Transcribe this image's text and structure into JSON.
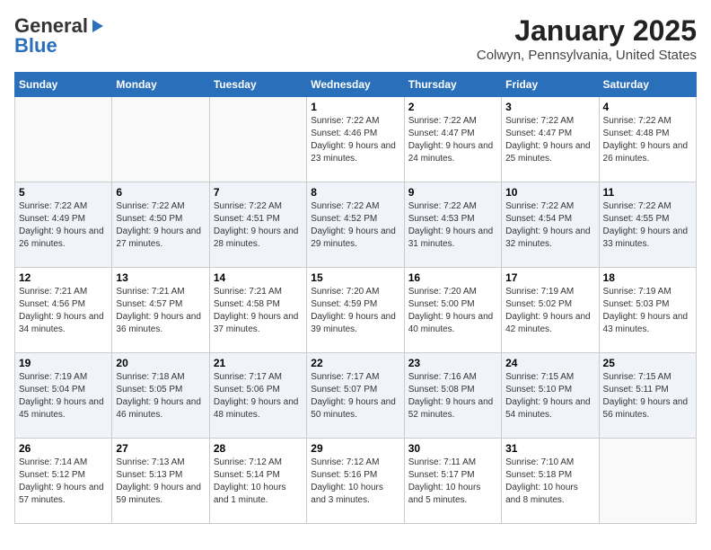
{
  "header": {
    "logo_general": "General",
    "logo_blue": "Blue",
    "month_title": "January 2025",
    "location": "Colwyn, Pennsylvania, United States"
  },
  "weekdays": [
    "Sunday",
    "Monday",
    "Tuesday",
    "Wednesday",
    "Thursday",
    "Friday",
    "Saturday"
  ],
  "weeks": [
    [
      {
        "day": "",
        "info": ""
      },
      {
        "day": "",
        "info": ""
      },
      {
        "day": "",
        "info": ""
      },
      {
        "day": "1",
        "info": "Sunrise: 7:22 AM\nSunset: 4:46 PM\nDaylight: 9 hours and 23 minutes."
      },
      {
        "day": "2",
        "info": "Sunrise: 7:22 AM\nSunset: 4:47 PM\nDaylight: 9 hours and 24 minutes."
      },
      {
        "day": "3",
        "info": "Sunrise: 7:22 AM\nSunset: 4:47 PM\nDaylight: 9 hours and 25 minutes."
      },
      {
        "day": "4",
        "info": "Sunrise: 7:22 AM\nSunset: 4:48 PM\nDaylight: 9 hours and 26 minutes."
      }
    ],
    [
      {
        "day": "5",
        "info": "Sunrise: 7:22 AM\nSunset: 4:49 PM\nDaylight: 9 hours and 26 minutes."
      },
      {
        "day": "6",
        "info": "Sunrise: 7:22 AM\nSunset: 4:50 PM\nDaylight: 9 hours and 27 minutes."
      },
      {
        "day": "7",
        "info": "Sunrise: 7:22 AM\nSunset: 4:51 PM\nDaylight: 9 hours and 28 minutes."
      },
      {
        "day": "8",
        "info": "Sunrise: 7:22 AM\nSunset: 4:52 PM\nDaylight: 9 hours and 29 minutes."
      },
      {
        "day": "9",
        "info": "Sunrise: 7:22 AM\nSunset: 4:53 PM\nDaylight: 9 hours and 31 minutes."
      },
      {
        "day": "10",
        "info": "Sunrise: 7:22 AM\nSunset: 4:54 PM\nDaylight: 9 hours and 32 minutes."
      },
      {
        "day": "11",
        "info": "Sunrise: 7:22 AM\nSunset: 4:55 PM\nDaylight: 9 hours and 33 minutes."
      }
    ],
    [
      {
        "day": "12",
        "info": "Sunrise: 7:21 AM\nSunset: 4:56 PM\nDaylight: 9 hours and 34 minutes."
      },
      {
        "day": "13",
        "info": "Sunrise: 7:21 AM\nSunset: 4:57 PM\nDaylight: 9 hours and 36 minutes."
      },
      {
        "day": "14",
        "info": "Sunrise: 7:21 AM\nSunset: 4:58 PM\nDaylight: 9 hours and 37 minutes."
      },
      {
        "day": "15",
        "info": "Sunrise: 7:20 AM\nSunset: 4:59 PM\nDaylight: 9 hours and 39 minutes."
      },
      {
        "day": "16",
        "info": "Sunrise: 7:20 AM\nSunset: 5:00 PM\nDaylight: 9 hours and 40 minutes."
      },
      {
        "day": "17",
        "info": "Sunrise: 7:19 AM\nSunset: 5:02 PM\nDaylight: 9 hours and 42 minutes."
      },
      {
        "day": "18",
        "info": "Sunrise: 7:19 AM\nSunset: 5:03 PM\nDaylight: 9 hours and 43 minutes."
      }
    ],
    [
      {
        "day": "19",
        "info": "Sunrise: 7:19 AM\nSunset: 5:04 PM\nDaylight: 9 hours and 45 minutes."
      },
      {
        "day": "20",
        "info": "Sunrise: 7:18 AM\nSunset: 5:05 PM\nDaylight: 9 hours and 46 minutes."
      },
      {
        "day": "21",
        "info": "Sunrise: 7:17 AM\nSunset: 5:06 PM\nDaylight: 9 hours and 48 minutes."
      },
      {
        "day": "22",
        "info": "Sunrise: 7:17 AM\nSunset: 5:07 PM\nDaylight: 9 hours and 50 minutes."
      },
      {
        "day": "23",
        "info": "Sunrise: 7:16 AM\nSunset: 5:08 PM\nDaylight: 9 hours and 52 minutes."
      },
      {
        "day": "24",
        "info": "Sunrise: 7:15 AM\nSunset: 5:10 PM\nDaylight: 9 hours and 54 minutes."
      },
      {
        "day": "25",
        "info": "Sunrise: 7:15 AM\nSunset: 5:11 PM\nDaylight: 9 hours and 56 minutes."
      }
    ],
    [
      {
        "day": "26",
        "info": "Sunrise: 7:14 AM\nSunset: 5:12 PM\nDaylight: 9 hours and 57 minutes."
      },
      {
        "day": "27",
        "info": "Sunrise: 7:13 AM\nSunset: 5:13 PM\nDaylight: 9 hours and 59 minutes."
      },
      {
        "day": "28",
        "info": "Sunrise: 7:12 AM\nSunset: 5:14 PM\nDaylight: 10 hours and 1 minute."
      },
      {
        "day": "29",
        "info": "Sunrise: 7:12 AM\nSunset: 5:16 PM\nDaylight: 10 hours and 3 minutes."
      },
      {
        "day": "30",
        "info": "Sunrise: 7:11 AM\nSunset: 5:17 PM\nDaylight: 10 hours and 5 minutes."
      },
      {
        "day": "31",
        "info": "Sunrise: 7:10 AM\nSunset: 5:18 PM\nDaylight: 10 hours and 8 minutes."
      },
      {
        "day": "",
        "info": ""
      }
    ]
  ]
}
